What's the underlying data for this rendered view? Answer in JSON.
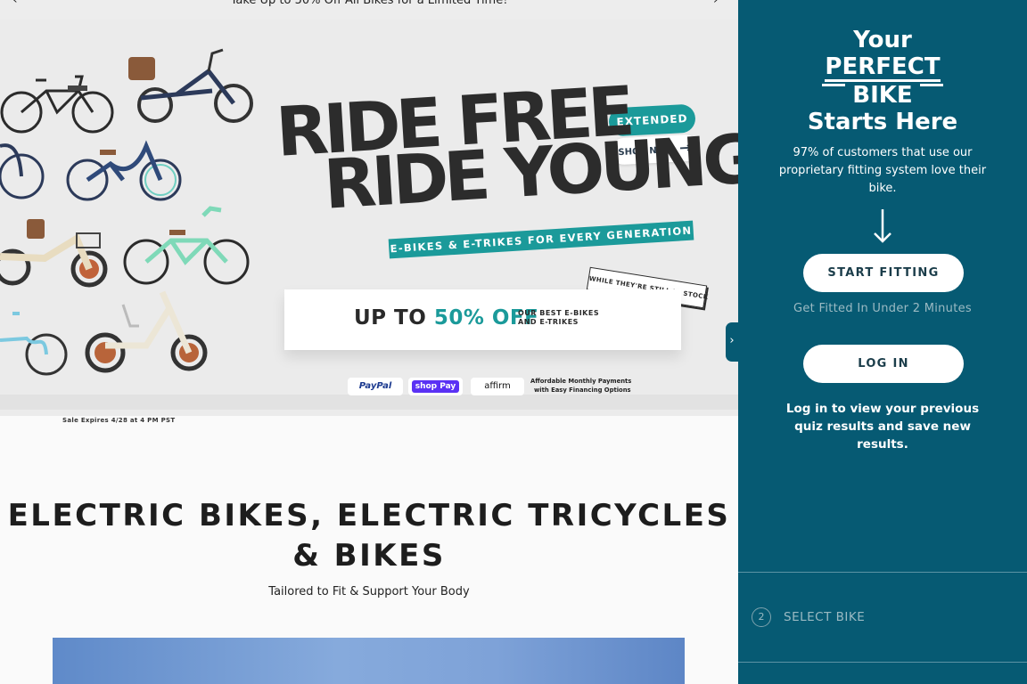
{
  "announcement": {
    "text": "Take Up to 50% Off All Bikes for a Limited Time!",
    "prev_icon": "chevron-left-icon",
    "next_icon": "chevron-right-icon"
  },
  "hero": {
    "headline_line1": "RIDE FREE",
    "headline_line2": "RIDE YOUNG",
    "extended_label": "EXTENDED",
    "shop_now_label": "SHOP NOW",
    "tagline": "E-BIKES & E-TRIKES FOR EVERY GENERATION",
    "offer_prefix": "UP TO",
    "offer_percent": "50% OFF",
    "offer_detail_line1": "OUR BEST E-BIKES",
    "offer_detail_line2": "AND E-TRIKES",
    "stock_tag": "WHILE THEY'RE STILL IN STOCK",
    "payments": [
      "PayPal",
      "shop Pay",
      "affirm"
    ],
    "financing_line1": "Affordable Monthly Payments",
    "financing_line2": "with Easy Financing Options",
    "sale_expires": "Sale Expires 4/28 at 4 PM PST",
    "colors": {
      "teal": "#1b9a9a",
      "dark_text": "#2c2c2c"
    }
  },
  "section": {
    "title": "ELECTRIC BIKES, ELECTRIC TRICYCLES & BIKES",
    "subtitle": "Tailored to Fit & Support Your Body"
  },
  "panel": {
    "title_line1": "Your",
    "title_line2": "PERFECT",
    "title_line3": "BIKE",
    "title_line4": "Starts Here",
    "intro": "97% of customers that use our proprietary fitting system love their bike.",
    "start_fitting_label": "START FITTING",
    "fitted_note": "Get Fitted In Under 2 Minutes",
    "login_label": "LOG IN",
    "login_note": "Log in to view your previous quiz results and save new results.",
    "step_number": "2",
    "step_label": "SELECT BIKE",
    "toggle_glyph": "›",
    "colors": {
      "background": "#065a73",
      "muted": "#9bbac3"
    }
  }
}
